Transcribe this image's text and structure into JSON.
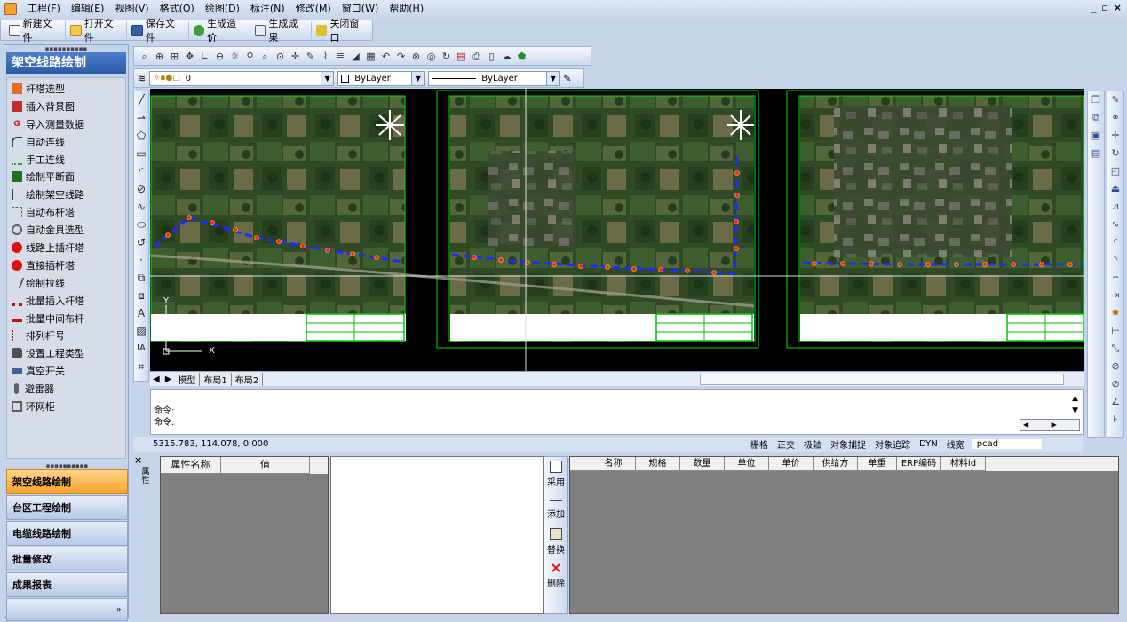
{
  "menu": {
    "items": [
      "工程(F)",
      "编辑(E)",
      "视图(V)",
      "格式(O)",
      "绘图(D)",
      "标注(N)",
      "修改(M)",
      "窗口(W)",
      "帮助(H)"
    ],
    "window_controls": [
      "_",
      "▫",
      "×"
    ]
  },
  "toolbar": {
    "new_file": "新建文件",
    "open_file": "打开文件",
    "save_file": "保存文件",
    "gen_price": "生成造价",
    "gen_result": "生成成果",
    "close_window": "关闭窗口"
  },
  "sidebar": {
    "title": "架空线路绘制",
    "items": [
      {
        "label": "杆塔选型",
        "icon": "tower-icon",
        "color": "#e07020"
      },
      {
        "label": "插入背景图",
        "icon": "image-icon",
        "color": "#c03030"
      },
      {
        "label": "导入测量数据",
        "icon": "import-icon",
        "color": "#d02020"
      },
      {
        "label": "自动连线",
        "icon": "autoline-icon",
        "color": "#404040"
      },
      {
        "label": "手工连线",
        "icon": "manualline-icon",
        "color": "#30a030"
      },
      {
        "label": "绘制平断面",
        "icon": "profile-icon",
        "color": "#207020"
      },
      {
        "label": "绘制架空线路",
        "icon": "overhead-line-icon",
        "color": "#404040"
      },
      {
        "label": "自动布杆塔",
        "icon": "auto-tower-icon",
        "color": "#606060"
      },
      {
        "label": "自动金具选型",
        "icon": "fitting-icon",
        "color": "#606060"
      },
      {
        "label": "线路上插杆塔",
        "icon": "red-dot-icon",
        "color": "#e01010"
      },
      {
        "label": "直接插杆塔",
        "icon": "red-dot-icon",
        "color": "#e01010"
      },
      {
        "label": "绘制拉线",
        "icon": "guy-wire-icon",
        "color": "#606060"
      },
      {
        "label": "批量插入杆塔",
        "icon": "batch-tower-icon",
        "color": "#c01010"
      },
      {
        "label": "批量中间布杆",
        "icon": "batch-mid-icon",
        "color": "#c01010"
      },
      {
        "label": "排列杆号",
        "icon": "number-icon",
        "color": "#c01010"
      },
      {
        "label": "设置工程类型",
        "icon": "settings-icon",
        "color": "#505050"
      },
      {
        "label": "真空开关",
        "icon": "switch-icon",
        "color": "#4060a0"
      },
      {
        "label": "避雷器",
        "icon": "arrester-icon",
        "color": "#606060"
      },
      {
        "label": "环网柜",
        "icon": "ring-cabinet-icon",
        "color": "#606060"
      }
    ],
    "tabs": [
      "架空线路绘制",
      "台区工程绘制",
      "电缆线路绘制",
      "批量修改",
      "成果报表"
    ],
    "active_tab": "架空线路绘制"
  },
  "layer_bar": {
    "layer_value": "0",
    "color_value": "ByLayer",
    "linetype_value": "ByLayer"
  },
  "layout_tabs": [
    "模型",
    "布局1",
    "布局2"
  ],
  "command": {
    "lines": [
      "命令:",
      "命令:"
    ]
  },
  "status": {
    "coords": "5315.783,  114.078,  0.000",
    "toggles": [
      "栅格",
      "正交",
      "极轴",
      "对象捕捉",
      "对象追踪",
      "DYN",
      "线宽",
      "pcad"
    ]
  },
  "properties": {
    "side_label": "属性",
    "col_name": "属性名称",
    "col_value": "值"
  },
  "actions": {
    "adopt": "采用",
    "add": "添加",
    "replace": "替换",
    "delete": "删除"
  },
  "material_grid": {
    "columns": [
      "名称",
      "规格",
      "数量",
      "单位",
      "单价",
      "供给方",
      "单重",
      "ERP编码",
      "材料id"
    ]
  },
  "ucs": {
    "y_label": "Y",
    "x_label": "X"
  },
  "colors": {
    "accent_blue": "#2b5aa8",
    "active_tab": "#f6a42b",
    "line_blue": "#1a2cff",
    "tower_red": "#ff2020",
    "frame_green": "#00ff00"
  }
}
